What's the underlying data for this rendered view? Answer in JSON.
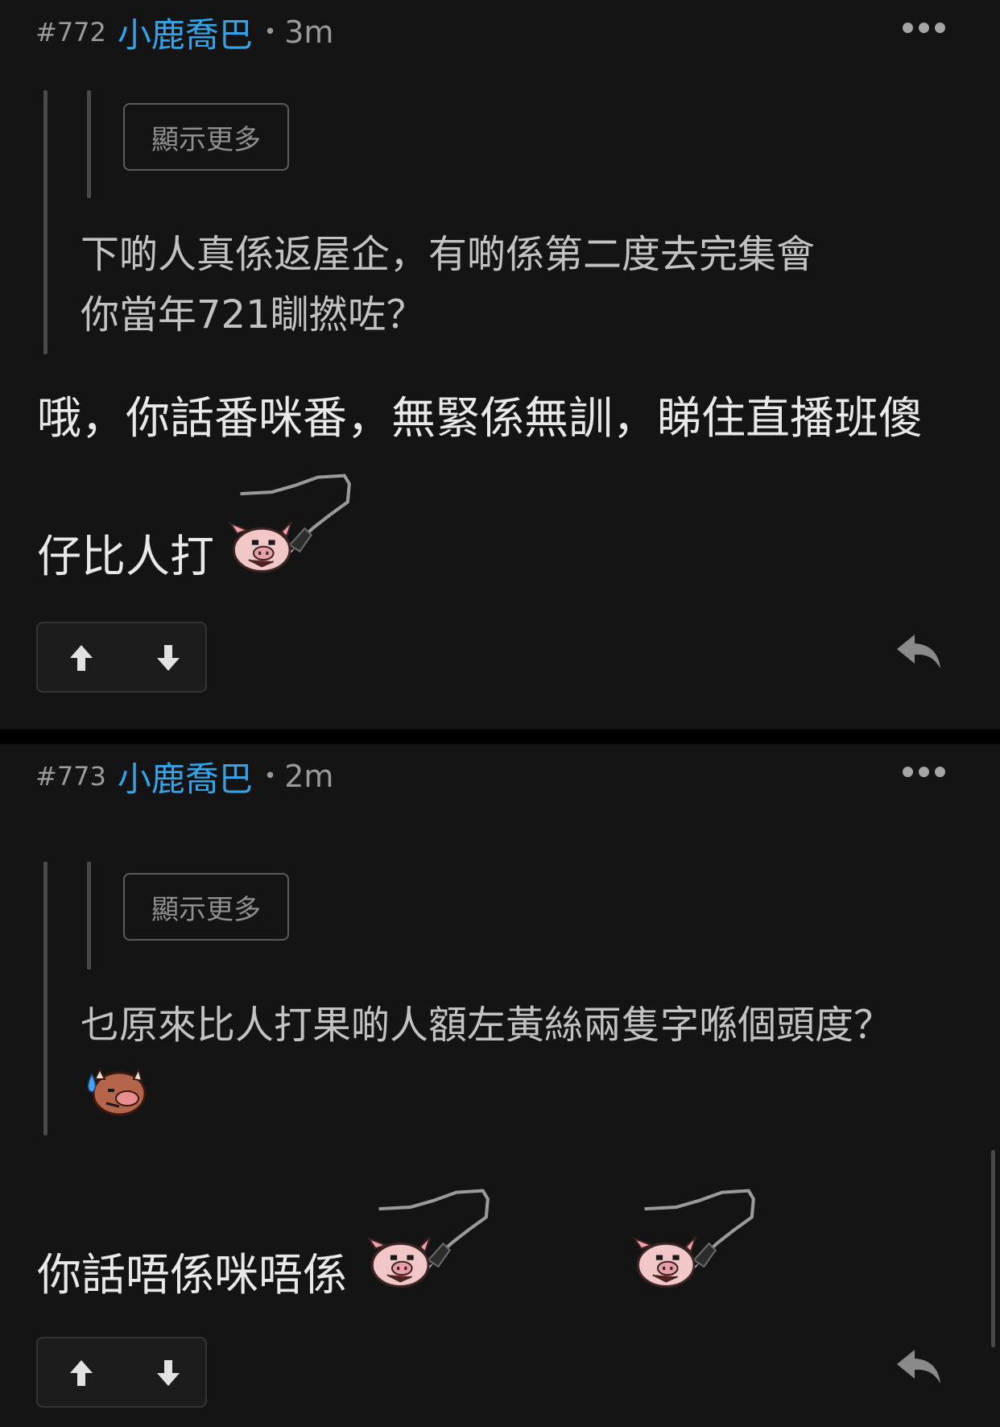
{
  "posts": [
    {
      "number": "#772",
      "username": "小鹿喬巴",
      "separator": "•",
      "time": "3m",
      "show_more_label": "顯示更多",
      "quote_lines": [
        "下啲人真係返屋企，有啲係第二度去完集會",
        "你當年721瞓撚咗？"
      ],
      "body_lines": [
        "哦，你話番咪番，無緊係無訓，睇住直播班傻",
        "仔比人打"
      ],
      "emojis": [
        "pig-whip-icon"
      ]
    },
    {
      "number": "#773",
      "username": "小鹿喬巴",
      "separator": "•",
      "time": "2m",
      "show_more_label": "顯示更多",
      "quote_lines": [
        "乜原來比人打果啲人額左黃絲兩隻字喺個頭度？"
      ],
      "quote_emojis": [
        "sweating-face-icon"
      ],
      "body_lines": [
        "你話唔係咪唔係"
      ],
      "emojis": [
        "pig-whip-icon",
        "pig-whip-icon"
      ]
    }
  ],
  "colors": {
    "background": "#141414",
    "username": "#34a3e8",
    "muted": "#9a9a9a",
    "separator": "#000000"
  }
}
